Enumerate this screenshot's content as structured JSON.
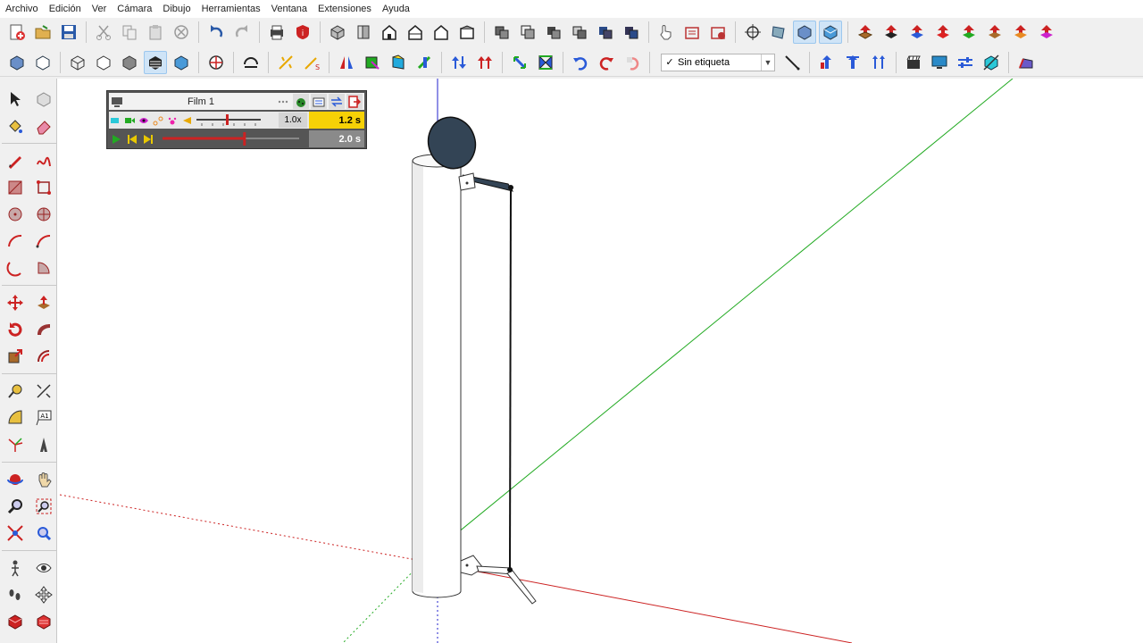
{
  "menu": [
    "Archivo",
    "Edición",
    "Ver",
    "Cámara",
    "Dibujo",
    "Herramientas",
    "Ventana",
    "Extensiones",
    "Ayuda"
  ],
  "toolbar": {
    "tag_check": "✓",
    "tag_label": "Sin etiqueta",
    "tag_arrow": "▼"
  },
  "film_panel": {
    "title": "Film 1",
    "speed": "1.0x",
    "current_time": "1.2 s",
    "total_time": "2.0 s",
    "progress_fraction": 0.6
  },
  "colors": {
    "x_axis": "#cc2222",
    "y_axis": "#22aa22",
    "z_axis": "#2222cc",
    "mechanism_dark": "#334455",
    "time_highlight": "#f6d106"
  }
}
